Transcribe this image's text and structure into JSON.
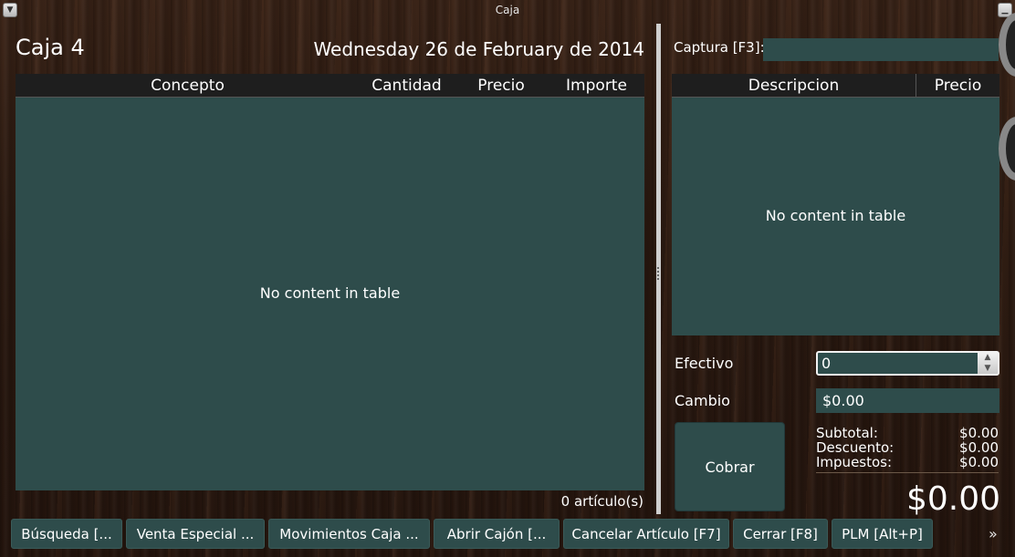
{
  "window": {
    "title": "Caja"
  },
  "left": {
    "caja_name": "Caja 4",
    "date": "Wednesday 26 de February de 2014",
    "table": {
      "headers": [
        "Concepto",
        "Cantidad",
        "Precio",
        "Importe"
      ],
      "empty_message": "No content in table"
    },
    "item_count": "0 artículo(s)"
  },
  "right": {
    "captura_label": "Captura [F3]:",
    "captura_value": "",
    "table": {
      "headers": [
        "Descripcion",
        "Precio"
      ],
      "empty_message": "No content in table"
    },
    "efectivo_label": "Efectivo",
    "efectivo_value": "0",
    "cambio_label": "Cambio",
    "cambio_value": "$0.00",
    "cobrar_label": "Cobrar",
    "totals": [
      {
        "label": "Subtotal:",
        "value": "$0.00"
      },
      {
        "label": "Descuento:",
        "value": "$0.00"
      },
      {
        "label": "Impuestos:",
        "value": "$0.00"
      }
    ],
    "grand_total": "$0.00"
  },
  "bottom_buttons": [
    "Búsqueda [...",
    "Venta Especial ...",
    "Movimientos Caja ...",
    "Abrir Cajón [...",
    "Cancelar Artículo [F7]",
    "Cerrar [F8]",
    "PLM [Alt+P]"
  ],
  "icons": {
    "window_menu": "triangle-down-icon",
    "minimize": "minimize-icon",
    "more": "double-chevron-right-icon"
  },
  "colors": {
    "panel": "#2e4c4b",
    "header": "#1e1e1e",
    "wood": "#2b1a11"
  }
}
